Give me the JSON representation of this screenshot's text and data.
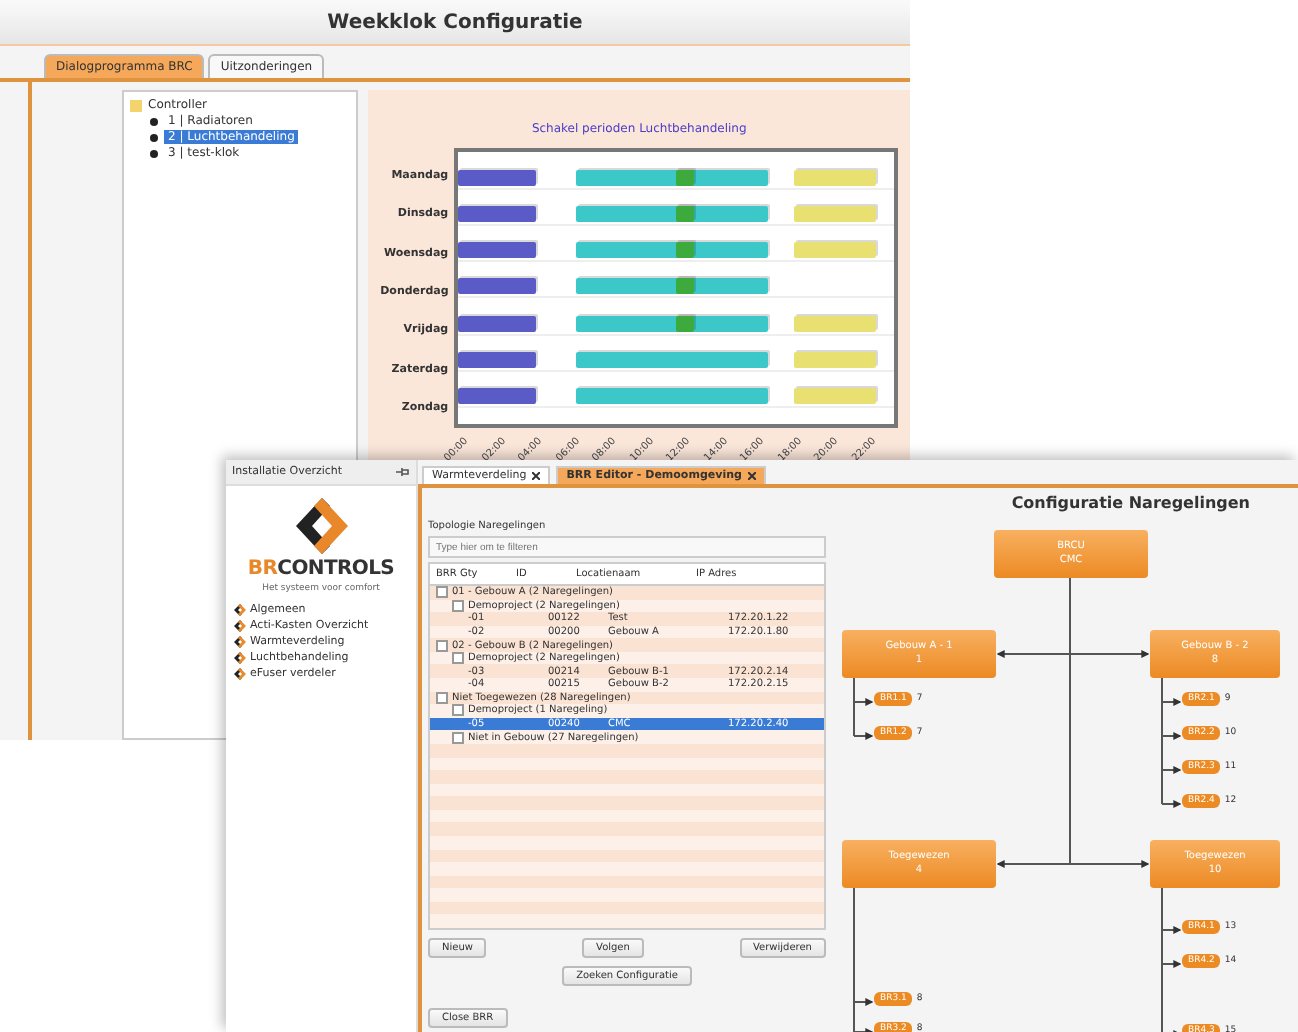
{
  "weekklok": {
    "title": "Weekklok Configuratie",
    "tabs": [
      {
        "label": "Dialogprogramma BRC",
        "selected": true
      },
      {
        "label": "Uitzonderingen",
        "selected": false
      }
    ],
    "tree": {
      "label": "Controller",
      "children": [
        {
          "label": "1 | Radiatoren",
          "selected": false
        },
        {
          "label": "2 | Luchtbehandeling",
          "selected": true
        },
        {
          "label": "3 | test-klok",
          "selected": false
        }
      ]
    },
    "schedule": {
      "title": "Schakel perioden Luchtbehandeling",
      "ticks": [
        "00:00",
        "02:00",
        "04:00",
        "06:00",
        "08:00",
        "10:00",
        "12:00",
        "14:00",
        "16:00",
        "18:00",
        "20:00",
        "22:00"
      ],
      "days": [
        {
          "label": "Maandag",
          "periods": [
            {
              "kind": "night",
              "color": "#5b5bc8"
            },
            {
              "kind": "day",
              "color": "#3cc8c8"
            },
            {
              "kind": "noon",
              "color": "#3caa3c"
            },
            {
              "kind": "evening",
              "color": "#e8e070"
            }
          ]
        },
        {
          "label": "Dinsdag",
          "periods": [
            {
              "kind": "night",
              "color": "#5b5bc8"
            },
            {
              "kind": "day",
              "color": "#3cc8c8"
            },
            {
              "kind": "noon",
              "color": "#3caa3c"
            },
            {
              "kind": "evening",
              "color": "#e8e070"
            }
          ]
        },
        {
          "label": "Woensdag",
          "periods": [
            {
              "kind": "night",
              "color": "#5b5bc8"
            },
            {
              "kind": "day",
              "color": "#3cc8c8"
            },
            {
              "kind": "noon",
              "color": "#3caa3c"
            },
            {
              "kind": "evening",
              "color": "#e8e070"
            }
          ]
        },
        {
          "label": "Donderdag",
          "periods": [
            {
              "kind": "night",
              "color": "#5b5bc8"
            },
            {
              "kind": "day",
              "color": "#3cc8c8"
            },
            {
              "kind": "noon",
              "color": "#3caa3c"
            }
          ]
        },
        {
          "label": "Vrijdag",
          "periods": [
            {
              "kind": "night",
              "color": "#5b5bc8"
            },
            {
              "kind": "day",
              "color": "#3cc8c8"
            },
            {
              "kind": "noon",
              "color": "#3caa3c"
            },
            {
              "kind": "evening",
              "color": "#e8e070"
            }
          ]
        },
        {
          "label": "Zaterdag",
          "periods": [
            {
              "kind": "night",
              "color": "#5b5bc8"
            },
            {
              "kind": "day",
              "color": "#3cc8c8"
            },
            {
              "kind": "evening",
              "color": "#e8e070"
            }
          ]
        },
        {
          "label": "Zondag",
          "periods": [
            {
              "kind": "night",
              "color": "#5b5bc8"
            },
            {
              "kind": "day",
              "color": "#3cc8c8"
            },
            {
              "kind": "evening",
              "color": "#e8e070"
            }
          ]
        }
      ]
    }
  },
  "editor": {
    "sidebar": {
      "title": "Installatie Overzicht",
      "logo": {
        "accent": "BR",
        "rest": "CONTROLS",
        "tagline": "Het systeem voor comfort"
      },
      "items": [
        "Algemeen",
        "Acti-Kasten Overzicht",
        "Warmteverdeling",
        "Luchtbehandeling",
        "eFuser verdeler"
      ]
    },
    "tabs": [
      {
        "label": "Warmteverdeling",
        "selected": false
      },
      {
        "label": "BRR Editor - Demoomgeving",
        "selected": true
      }
    ],
    "title": "Configuratie Naregelingen",
    "topology": {
      "label": "Topologie Naregelingen",
      "filter": {
        "placeholder": "Type hier om te filteren"
      },
      "columns": [
        "BRR Gty",
        "ID",
        "Locatienaam",
        "IP Adres"
      ],
      "rows": [
        {
          "label": "01 - Gebouw A (2 Naregelingen)",
          "children": [
            {
              "label": "Demoproject (2 Naregelingen)",
              "children": [
                {
                  "cells": [
                    "-01",
                    "00122",
                    "Test",
                    "172.20.1.22"
                  ],
                  "selected": false
                },
                {
                  "cells": [
                    "-02",
                    "00200",
                    "Gebouw A",
                    "172.20.1.80"
                  ],
                  "selected": false
                }
              ]
            }
          ]
        },
        {
          "label": "02 - Gebouw B (2 Naregelingen)",
          "children": [
            {
              "label": "Demoproject (2 Naregelingen)",
              "children": [
                {
                  "cells": [
                    "-03",
                    "00214",
                    "Gebouw B-1",
                    "172.20.2.14"
                  ],
                  "selected": false
                },
                {
                  "cells": [
                    "-04",
                    "00215",
                    "Gebouw B-2",
                    "172.20.2.15"
                  ],
                  "selected": false
                }
              ]
            }
          ]
        },
        {
          "label": "Niet Toegewezen (28 Naregelingen)",
          "children": [
            {
              "label": "Demoproject (1 Naregeling)",
              "children": [
                {
                  "cells": [
                    "-05",
                    "00240",
                    "CMC",
                    "172.20.2.40"
                  ],
                  "selected": true
                }
              ]
            },
            {
              "label": "Niet in Gebouw (27 Naregelingen)"
            }
          ]
        }
      ],
      "buttons": [
        "Nieuw",
        "Volgen",
        "Verwijderen"
      ],
      "search_button": "Zoeken Configuratie",
      "close_button": "Close BRR"
    },
    "diagram": {
      "root": {
        "name": "BRCU",
        "id": "CMC"
      },
      "groups": [
        {
          "name": "Gebouw A - 1",
          "id": "1",
          "leaves": [
            {
              "name": "BR1.1",
              "id": "7"
            },
            {
              "name": "BR1.2",
              "id": "7"
            }
          ]
        },
        {
          "name": "Gebouw B - 2",
          "id": "8",
          "leaves": [
            {
              "name": "BR2.1",
              "id": "9"
            },
            {
              "name": "BR2.2",
              "id": "10"
            },
            {
              "name": "BR2.3",
              "id": "11"
            },
            {
              "name": "BR2.4",
              "id": "12"
            }
          ]
        },
        {
          "name": "Toegewezen",
          "id": "4",
          "leaves": [
            {
              "name": "BR3.1",
              "id": "8"
            },
            {
              "name": "BR3.2",
              "id": "8"
            }
          ]
        },
        {
          "name": "Toegewezen",
          "id": "10",
          "leaves": [
            {
              "name": "BR4.1",
              "id": "13"
            },
            {
              "name": "BR4.2",
              "id": "14"
            },
            {
              "name": "BR4.3",
              "id": "15"
            }
          ]
        }
      ]
    }
  }
}
